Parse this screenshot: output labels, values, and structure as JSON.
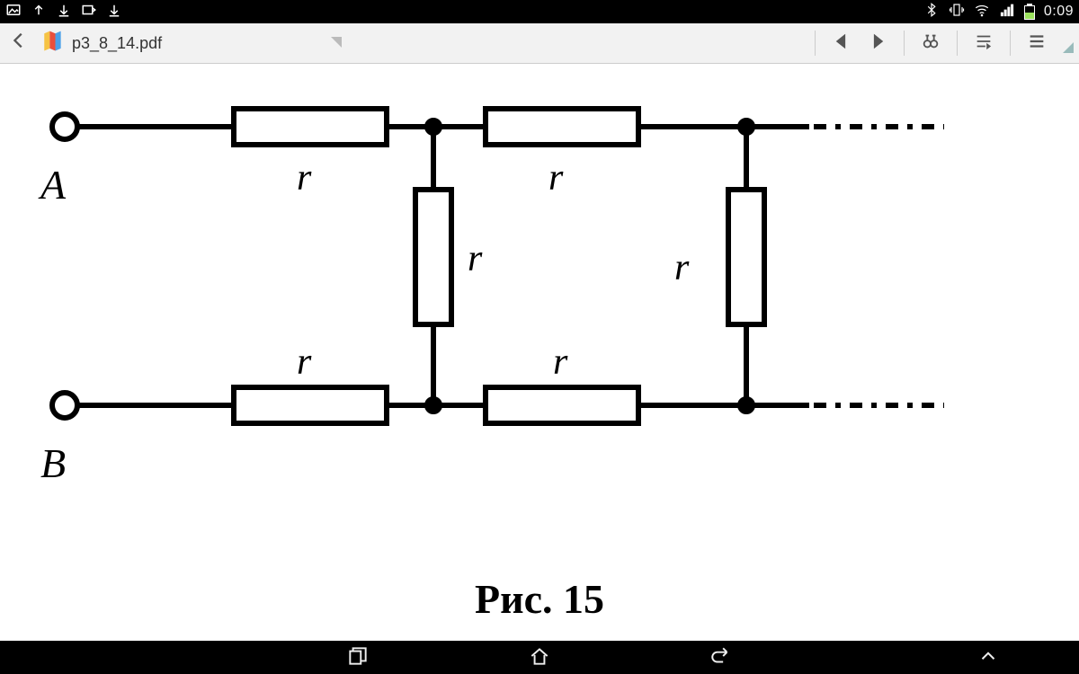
{
  "status": {
    "clock": "0:09"
  },
  "app": {
    "filename": "p3_8_14.pdf"
  },
  "diagram": {
    "terminal_top": "A",
    "terminal_bottom": "B",
    "labels": {
      "r_top1": "r",
      "r_top2": "r",
      "r_mid1": "r",
      "r_mid2": "r",
      "r_bot1": "r",
      "r_bot2": "r"
    },
    "caption": "Рис. 15",
    "description": "Infinite resistor ladder network between terminals A and B. Each section: two series resistors r on top and bottom rails, one shunt resistor r across. Network continues to the right (dashed).",
    "resistor_value_symbol": "r"
  }
}
